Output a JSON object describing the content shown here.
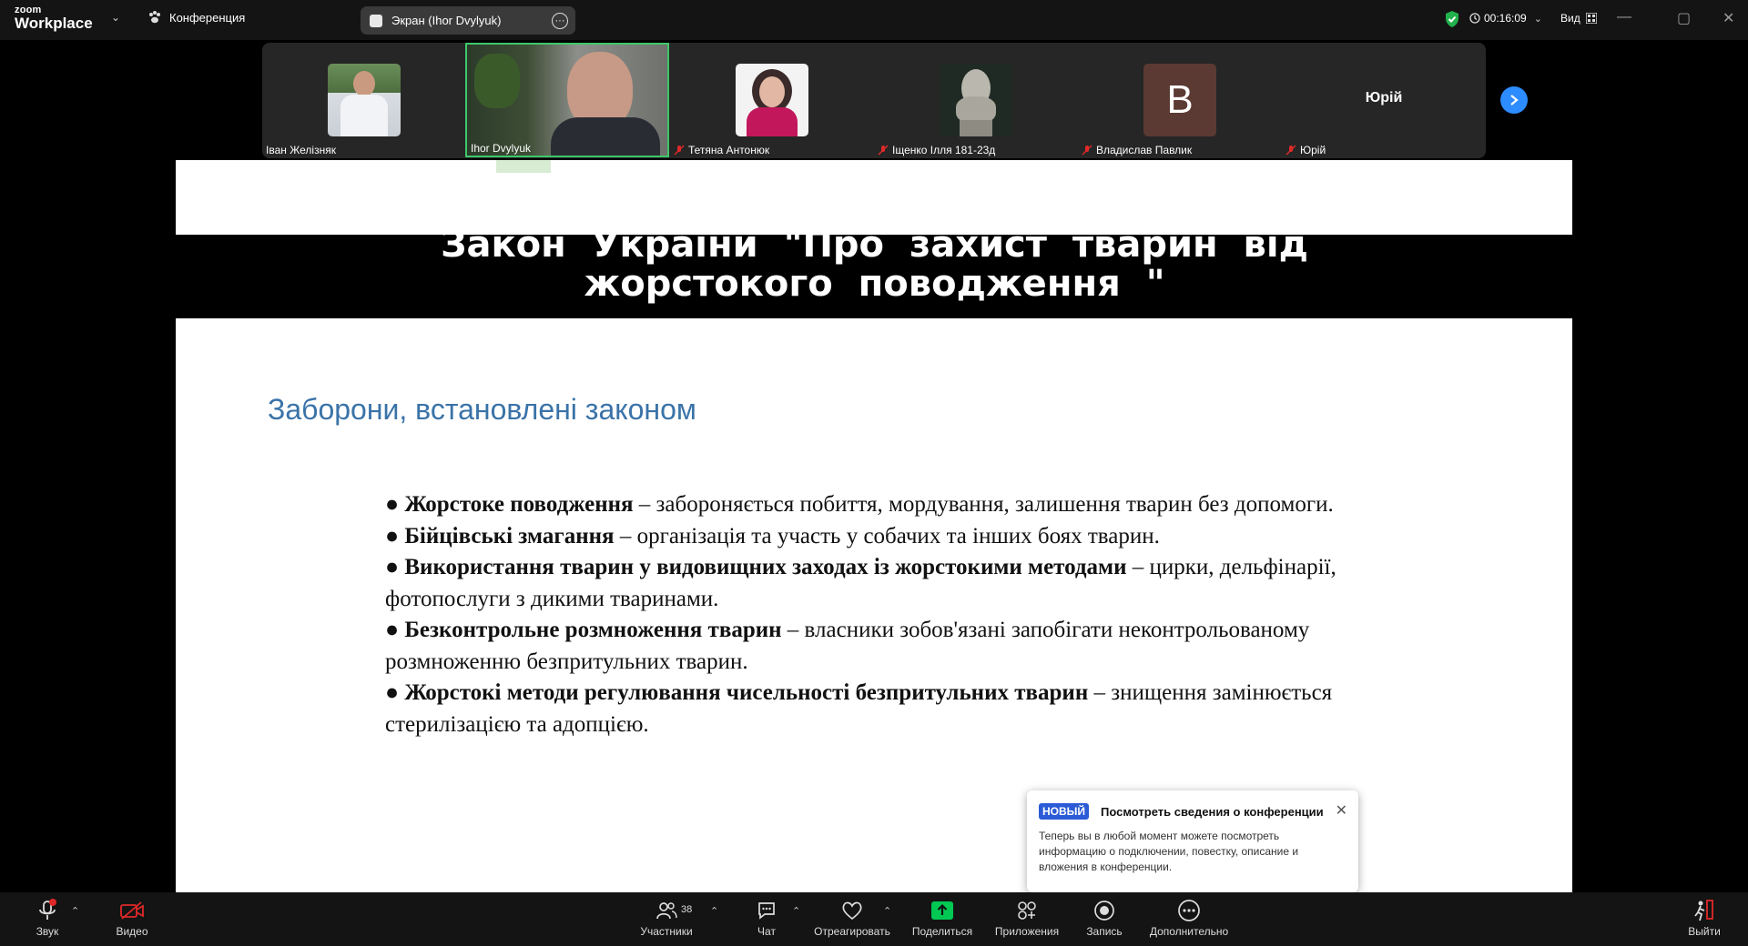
{
  "app": {
    "logo_small": "zoom",
    "logo_big": "Workplace",
    "conference_label": "Конференция",
    "screen_tab_label": "Экран (Ihor Dvylyuk)",
    "timer": "00:16:09",
    "view_label": "Вид"
  },
  "participants": [
    {
      "name": "Іван Желізняк",
      "muted": false,
      "type": "photo"
    },
    {
      "name": "Ihor Dvylyuk",
      "muted": false,
      "type": "video",
      "active": true
    },
    {
      "name": "Тетяна Антонюк",
      "muted": true,
      "type": "photo"
    },
    {
      "name": "Іщенко Ілля 181-23д",
      "muted": true,
      "type": "photo"
    },
    {
      "name": "Владислав Павлик",
      "muted": true,
      "type": "letter",
      "letter": "B"
    },
    {
      "name": "Юрій",
      "muted": true,
      "type": "text",
      "display": "Юрій"
    }
  ],
  "slide": {
    "title": "Закон України \"Про захист тварин від жорстокого поводження \"",
    "subtitle": "Заборони, встановлені законом",
    "items": [
      {
        "bullet": "●",
        "bold": "Жорстоке поводження",
        "text": " – забороняється побиття, мордування, залишення тварин без допомоги."
      },
      {
        "bullet": "●",
        "bold": "Бійцівські змагання",
        "text": " – організація та участь у собачих та інших боях тварин."
      },
      {
        "bullet": "●",
        "bold": "Використання тварин у видовищних заходах із жорстокими методами",
        "text": " – цирки, дельфінарії, фотопослуги з дикими тваринами."
      },
      {
        "bullet": "●",
        "bold": "Безконтрольне розмноження тварин",
        "text": " – власники зобов'язані запобігати неконтрольованому розмноженню безпритульних тварин."
      },
      {
        "bullet": "●",
        "bold": "Жорстокі методи регулювання чисельності безпритульних тварин",
        "text": " – знищення замінюється стерилізацією та адопцією."
      }
    ]
  },
  "popup": {
    "badge": "НОВЫЙ",
    "title": "Посмотреть сведения о конференции",
    "body": "Теперь вы в любой момент можете посмотреть информацию о подключении, повестку, описание и вложения в конференции."
  },
  "toolbar": {
    "audio": "Звук",
    "video": "Видео",
    "participants": "Участники",
    "participants_count": "38",
    "chat": "Чат",
    "react": "Отреагировать",
    "share": "Поделиться",
    "apps": "Приложения",
    "record": "Запись",
    "more": "Дополнительно",
    "leave": "Выйти"
  },
  "colors": {
    "share_green": "#00c853",
    "mute_red": "#e02828",
    "accent_blue": "#2d8cff",
    "slide_subtitle_blue": "#3a73a8"
  }
}
